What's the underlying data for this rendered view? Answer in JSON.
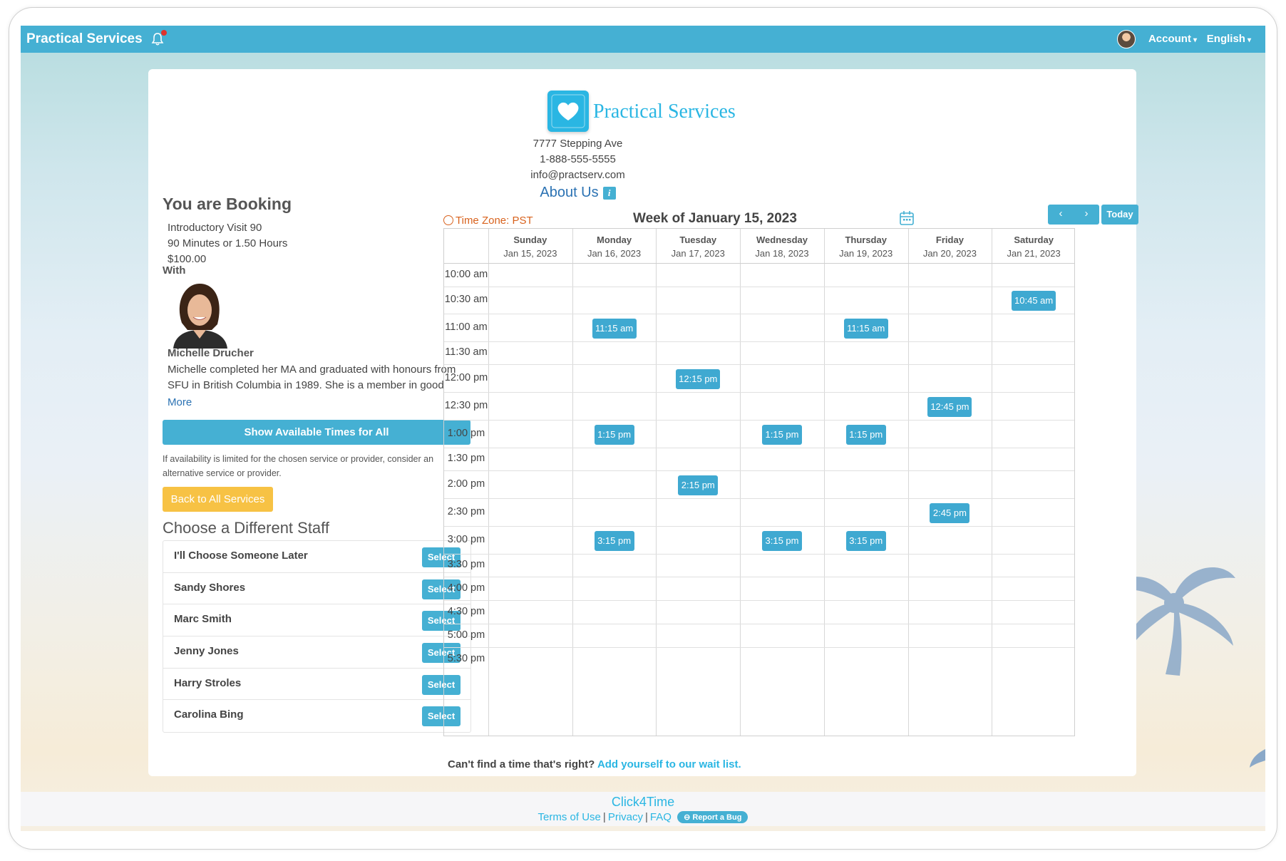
{
  "topbar": {
    "brand": "Practical Services",
    "account": "Account",
    "language": "English"
  },
  "business": {
    "name": "Practical Services",
    "address": "7777 Stepping Ave",
    "phone": "1-888-555-5555",
    "email": "info@practserv.com",
    "about": "About Us",
    "about_icon": "i"
  },
  "booking": {
    "heading": "You are Booking",
    "service": "Introductory Visit 90",
    "duration": "90 Minutes or 1.50 Hours",
    "price": "$100.00",
    "with_label": "With",
    "staff_name": "Michelle Drucher",
    "staff_bio": "Michelle completed her MA and graduated with honours from SFU in British Columbia in 1989. She is a member in good",
    "more": "More",
    "show_all_btn": "Show Available Times for All",
    "hint": "If availability is limited for the chosen service or provider, consider an alternative service or provider.",
    "back_btn": "Back to All Services",
    "choose_staff_heading": "Choose a Different Staff",
    "select_label": "Select",
    "staff_options": [
      "I'll Choose Someone Later",
      "Sandy Shores",
      "Marc Smith",
      "Jenny Jones",
      "Harry Stroles",
      "Carolina Bing"
    ]
  },
  "calendar": {
    "timezone": "Time Zone: PST",
    "week_title": "Week of January 15, 2023",
    "prev": "‹",
    "next": "›",
    "today": "Today",
    "days": [
      {
        "name": "Sunday",
        "date": "Jan 15, 2023"
      },
      {
        "name": "Monday",
        "date": "Jan 16, 2023"
      },
      {
        "name": "Tuesday",
        "date": "Jan 17, 2023"
      },
      {
        "name": "Wednesday",
        "date": "Jan 18, 2023"
      },
      {
        "name": "Thursday",
        "date": "Jan 19, 2023"
      },
      {
        "name": "Friday",
        "date": "Jan 20, 2023"
      },
      {
        "name": "Saturday",
        "date": "Jan 21, 2023"
      }
    ],
    "times": [
      "10:00 am",
      "10:30 am",
      "11:00 am",
      "11:30 am",
      "12:00 pm",
      "12:30 pm",
      "1:00 pm",
      "1:30 pm",
      "2:00 pm",
      "2:30 pm",
      "3:00 pm",
      "3:30 pm",
      "4:00 pm",
      "4:30 pm",
      "5:00 pm",
      "5:30 pm"
    ],
    "slots": [
      {
        "day": 6,
        "row": 1,
        "label": "10:45 am"
      },
      {
        "day": 1,
        "row": 2,
        "label": "11:15 am"
      },
      {
        "day": 4,
        "row": 2,
        "label": "11:15 am"
      },
      {
        "day": 2,
        "row": 4,
        "label": "12:15 pm"
      },
      {
        "day": 5,
        "row": 5,
        "label": "12:45 pm"
      },
      {
        "day": 1,
        "row": 6,
        "label": "1:15 pm"
      },
      {
        "day": 3,
        "row": 6,
        "label": "1:15 pm"
      },
      {
        "day": 4,
        "row": 6,
        "label": "1:15 pm"
      },
      {
        "day": 2,
        "row": 8,
        "label": "2:15 pm"
      },
      {
        "day": 5,
        "row": 9,
        "label": "2:45 pm"
      },
      {
        "day": 1,
        "row": 10,
        "label": "3:15 pm"
      },
      {
        "day": 3,
        "row": 10,
        "label": "3:15 pm"
      },
      {
        "day": 4,
        "row": 10,
        "label": "3:15 pm"
      }
    ],
    "waitlist_text": "Can't find a time that's right?",
    "waitlist_link": "Add yourself to our wait list."
  },
  "footer": {
    "brand": "Click4Time",
    "terms": "Terms of Use",
    "privacy": "Privacy",
    "faq": "FAQ",
    "separator": "|",
    "report_bug": "Report a Bug"
  },
  "colors": {
    "accent": "#45b0d3",
    "back_button": "#f7c244",
    "timezone": "#d8621d",
    "link": "#2b72b3"
  }
}
